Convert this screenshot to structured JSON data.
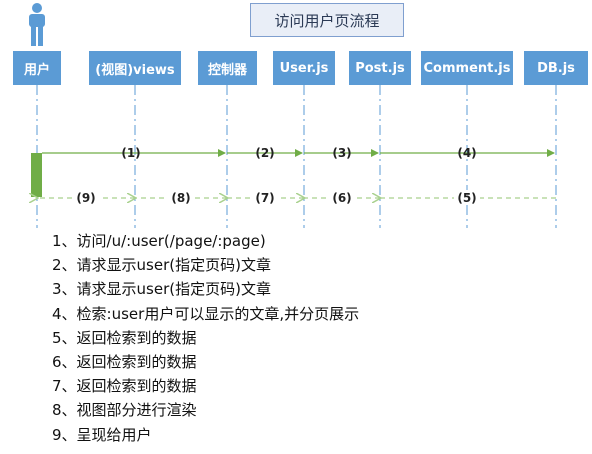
{
  "title": "访问用户页流程",
  "actors": [
    "用户",
    "(视图)views",
    "控制器",
    "User.js",
    "Post.js",
    "Comment.js",
    "DB.js"
  ],
  "requests": [
    "(1)",
    "(2)",
    "(3)",
    "(4)"
  ],
  "responses": [
    "(9)",
    "(8)",
    "(7)",
    "(6)",
    "(5)"
  ],
  "steps": [
    "1、访问/u/:user(/page/:page)",
    "2、请求显示user(指定页码)文章",
    "3、请求显示user(指定页码)文章",
    "4、检索:user用户可以显示的文章,并分页展示",
    "5、返回检索到的数据",
    "6、返回检索到的数据",
    "7、返回检索到的数据",
    "8、视图部分进行渲染",
    "9、呈现给用户"
  ],
  "colors": {
    "actor_box": "#5b9bd5",
    "lifeline": "#5b9bd5",
    "request_arrow": "#70ad47",
    "response_arrow": "#a9d18e",
    "activation_bar": "#70ad47",
    "person_icon": "#5b9bd5"
  },
  "icons": [
    "person-icon"
  ]
}
